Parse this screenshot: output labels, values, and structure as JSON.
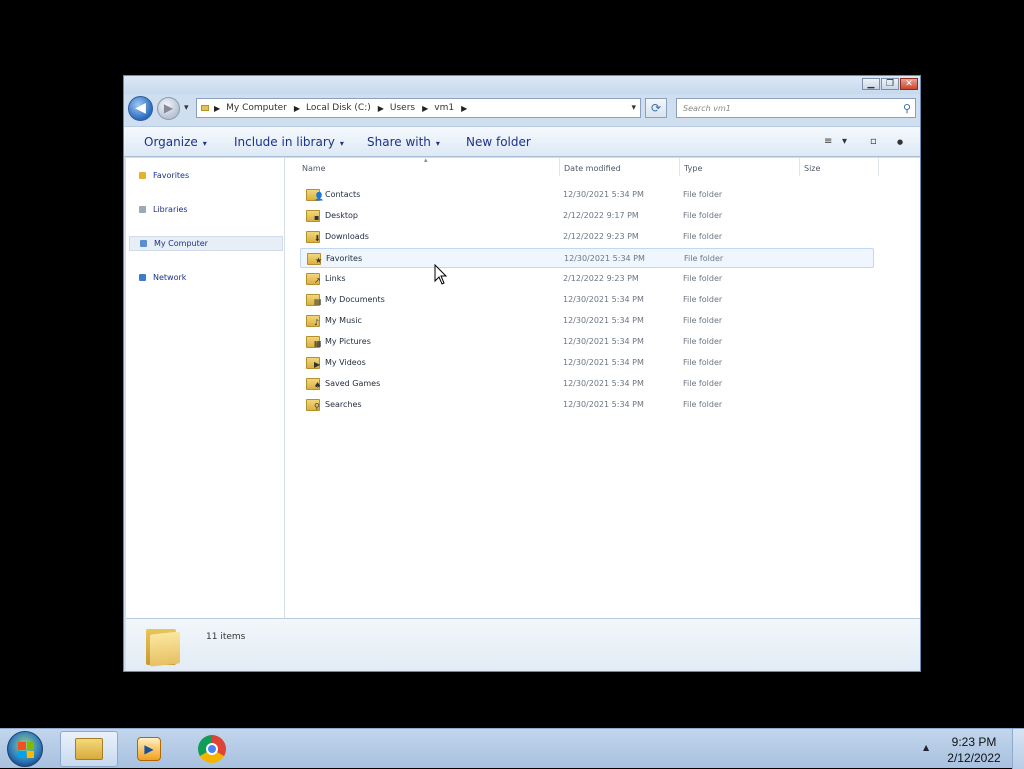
{
  "window": {
    "controls": [
      "▁",
      "❐",
      "✕"
    ]
  },
  "nav": {
    "back_glyph": "◀",
    "forward_glyph": "▶",
    "recent_glyph": "▾",
    "address": [
      "My Computer",
      "Local Disk (C:)",
      "Users",
      "vm1"
    ],
    "address_drop_glyph": "▾",
    "refresh_glyph": "⟳",
    "search_placeholder": "Search vm1",
    "search_icon_glyph": "⚲"
  },
  "command_bar": {
    "organize": "Organize",
    "include_in_library": "Include in library",
    "share_with": "Share with",
    "new_folder": "New folder",
    "caret": "▾",
    "view_glyph": "≡",
    "view_caret": "▾",
    "preview_glyph": "▫",
    "help_glyph": "●"
  },
  "sidebar": {
    "items": [
      {
        "label": "Favorites",
        "icon": "star-icon",
        "color": "#e6b12d"
      },
      {
        "label": "Libraries",
        "icon": "library-icon",
        "color": "#9aa8b8"
      },
      {
        "label": "My Computer",
        "icon": "computer-icon",
        "color": "#5c8ecf",
        "selected": true
      },
      {
        "label": "Network",
        "icon": "network-icon",
        "color": "#3e7cc9"
      }
    ]
  },
  "columns": {
    "name": "Name",
    "date_modified": "Date modified",
    "type": "Type",
    "size": "Size",
    "sort_glyph": "▴"
  },
  "files": [
    {
      "name": "Contacts",
      "date": "12/30/2021 5:34 PM",
      "type": "File folder",
      "badge": "👤"
    },
    {
      "name": "Desktop",
      "date": "2/12/2022 9:17 PM",
      "type": "File folder",
      "badge": "▪"
    },
    {
      "name": "Downloads",
      "date": "2/12/2022 9:23 PM",
      "type": "File folder",
      "badge": "⬇"
    },
    {
      "name": "Favorites",
      "date": "12/30/2021 5:34 PM",
      "type": "File folder",
      "badge": "★",
      "hover": true
    },
    {
      "name": "Links",
      "date": "2/12/2022 9:23 PM",
      "type": "File folder",
      "badge": "↗"
    },
    {
      "name": "My Documents",
      "date": "12/30/2021 5:34 PM",
      "type": "File folder",
      "badge": "▤"
    },
    {
      "name": "My Music",
      "date": "12/30/2021 5:34 PM",
      "type": "File folder",
      "badge": "♪"
    },
    {
      "name": "My Pictures",
      "date": "12/30/2021 5:34 PM",
      "type": "File folder",
      "badge": "▦"
    },
    {
      "name": "My Videos",
      "date": "12/30/2021 5:34 PM",
      "type": "File folder",
      "badge": "▶"
    },
    {
      "name": "Saved Games",
      "date": "12/30/2021 5:34 PM",
      "type": "File folder",
      "badge": "♠"
    },
    {
      "name": "Searches",
      "date": "12/30/2021 5:34 PM",
      "type": "File folder",
      "badge": "⚲"
    }
  ],
  "details": {
    "item_count": "11 items"
  },
  "taskbar": {
    "time": "9:23 PM",
    "date": "2/12/2022",
    "tray_glyph": "▲",
    "wmp_glyph": "▶"
  }
}
